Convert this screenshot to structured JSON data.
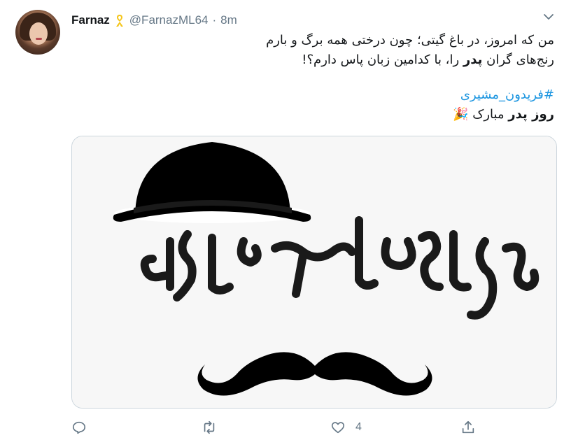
{
  "tweet": {
    "author": {
      "name": "Farnaz",
      "handle": "@FarnazML64",
      "time": "8m",
      "separator": "·",
      "badge_icon": "yellow-ribbon-icon",
      "avatar_icon": "profile-photo"
    },
    "text": {
      "line1": "من که امروز، در باغ گیتی؛ چون درختی همه برگ و بارم",
      "line2_pre": "رنج‌های گران ",
      "line2_bold": "پدر",
      "line2_post": " را، با کدامین زبان پاس دارم؟!",
      "hashtag": "#فریدون_مشیری",
      "line4_bold": "روز پدر",
      "line4_post": " مبارک ",
      "emoji": "🎉"
    },
    "media": {
      "calligraphy": "پدر، اولین همراهان",
      "description_icons": [
        "bowler-hat-icon",
        "mustache-icon"
      ]
    },
    "actions": {
      "reply_icon": "reply-icon",
      "retweet_icon": "retweet-icon",
      "like_icon": "heart-icon",
      "like_count": "4",
      "share_icon": "share-icon"
    },
    "menu_icon": "chevron-down-icon",
    "colors": {
      "text": "#14171a",
      "secondary": "#657786",
      "link": "#1b95e0",
      "border": "#ccd6dd"
    }
  }
}
